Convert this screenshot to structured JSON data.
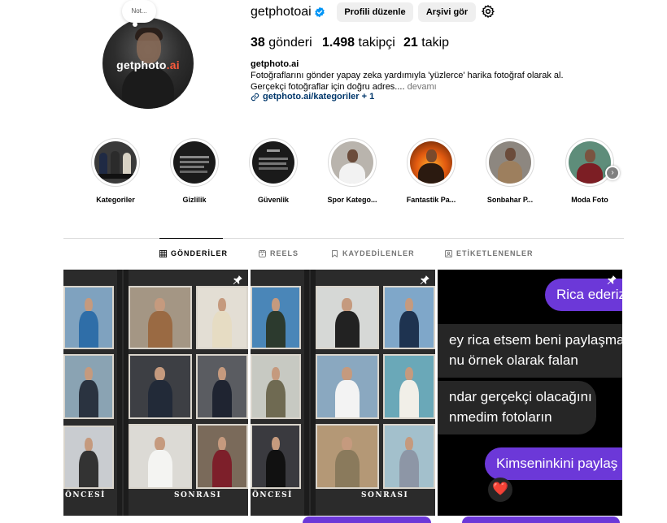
{
  "profile": {
    "username": "getphotoai",
    "note": "Not...",
    "avatar_brand": "getphoto",
    "avatar_brand_tld": ".ai",
    "edit_profile_label": "Profili düzenle",
    "archive_label": "Arşivi gör",
    "stats": [
      {
        "value": "38",
        "label": "gönderi"
      },
      {
        "value": "1.498",
        "label": "takipçi"
      },
      {
        "value": "21",
        "label": "takip"
      }
    ],
    "bio_name": "getphoto.ai",
    "bio_text": "Fotoğraflarını gönder yapay zeka yardımıyla 'yüzlerce' harika fotoğraf olarak al. Gerçekçi fotoğraflar için doğru adres....",
    "bio_more": "devamı",
    "link_text": "getphoto.ai/kategoriler + 1"
  },
  "highlights": [
    {
      "label": "Kategoriler"
    },
    {
      "label": "Gizlilik"
    },
    {
      "label": "Güvenlik"
    },
    {
      "label": "Spor Katego..."
    },
    {
      "label": "Fantastik Pa..."
    },
    {
      "label": "Sonbahar P..."
    },
    {
      "label": "Moda Foto"
    }
  ],
  "tabs": [
    {
      "label": "GÖNDERİLER",
      "icon": "grid-icon",
      "active": true
    },
    {
      "label": "REELS",
      "icon": "reels-icon",
      "active": false
    },
    {
      "label": "KAYDEDİLENLER",
      "icon": "bookmark-icon",
      "active": false
    },
    {
      "label": "ETİKETLENENLER",
      "icon": "tagged-icon",
      "active": false
    }
  ],
  "posts": [
    {
      "before_label": "ÖNCESİ",
      "after_label": "SONRASI",
      "pinned": true
    },
    {
      "before_label": "ÖNCESİ",
      "after_label": "SONRASI",
      "pinned": true
    },
    {
      "pinned": true,
      "messages": [
        {
          "side": "right",
          "text": "Rica ederiz"
        },
        {
          "side": "left",
          "text": "ey rica etsem beni paylaşmay"
        },
        {
          "side": "left",
          "text": "nu örnek olarak falan"
        },
        {
          "side": "left",
          "text": "ndar gerçekçi olacağını"
        },
        {
          "side": "left",
          "text": "nmedim fotoların"
        },
        {
          "side": "right",
          "text": "Kimseninkini paylaş"
        }
      ],
      "reaction": "❤️"
    }
  ],
  "colors": {
    "link": "#00376b",
    "verified": "#0095f6",
    "chat_purple": "#6c38d8",
    "chat_gray": "#262626"
  }
}
